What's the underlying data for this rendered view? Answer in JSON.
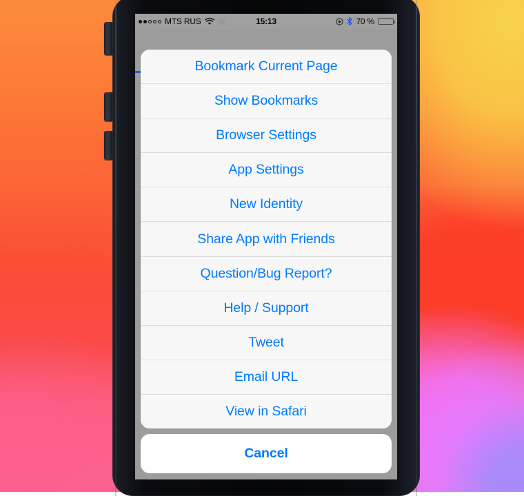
{
  "status_bar": {
    "signal_dots_filled": 2,
    "signal_dots_total": 5,
    "carrier": "MTS RUS",
    "wifi_icon": "wifi-icon",
    "sync_icon": "sync-spinner-icon",
    "time": "15:13",
    "location_icon": "location-services-icon",
    "bluetooth_icon": "bluetooth-icon",
    "battery_percent": "70 %",
    "battery_level": 70,
    "battery_icon": "battery-icon"
  },
  "action_sheet": {
    "items": [
      {
        "label": "Bookmark Current Page"
      },
      {
        "label": "Show Bookmarks"
      },
      {
        "label": "Browser Settings"
      },
      {
        "label": "App Settings"
      },
      {
        "label": "New Identity"
      },
      {
        "label": "Share App with Friends"
      },
      {
        "label": "Question/Bug Report?"
      },
      {
        "label": "Help / Support"
      },
      {
        "label": "Tweet"
      },
      {
        "label": "Email URL"
      },
      {
        "label": "View in Safari"
      }
    ],
    "cancel_label": "Cancel"
  },
  "colors": {
    "accent_blue": "#007aff",
    "progress_blue": "#0b63d6",
    "sheet_background": "#f7f7f7",
    "cancel_background": "#ffffff",
    "dimmed_backdrop": "#9c9c9c",
    "status_bar_background": "#a0a0a0"
  }
}
